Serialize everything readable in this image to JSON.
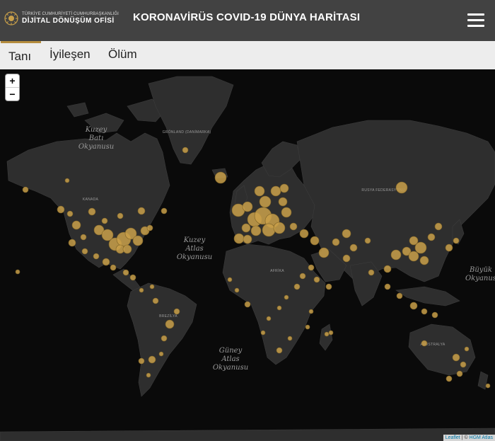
{
  "header": {
    "logo_top": "TÜRKİYE CUMHURİYETİ CUMHURBAŞKANLIĞI",
    "logo_main": "DİJİTAL DÖNÜŞÜM OFİSİ",
    "title": "KORONAVİRÜS COVID-19 DÜNYA HARİTASI",
    "menu_icon": "hamburger-menu-icon"
  },
  "tabs": [
    {
      "label": "Tanı",
      "active": true
    },
    {
      "label": "İyileşen",
      "active": false
    },
    {
      "label": "Ölüm",
      "active": false
    }
  ],
  "map": {
    "zoom_in": "+",
    "zoom_out": "−",
    "attribution_link": "Leaflet",
    "attribution_sep": " | © ",
    "attribution_source": "HGM Atlas",
    "oceans": [
      {
        "line1": "Kuzey",
        "line2": "Batı",
        "line3": "Okyanusu"
      },
      {
        "line1": "Kuzey",
        "line2": "Atlas",
        "line3": "Okyanusu"
      },
      {
        "line1": "Güney",
        "line2": "Atlas",
        "line3": "Okyanusu"
      },
      {
        "line1": "Büyük",
        "line2": "Okyanus",
        "line3": ""
      }
    ],
    "countries": [
      "GRÖNLAND (DANİMARKA)",
      "KANADA",
      "RUSYA FEDERASYONU",
      "BREZİLYA",
      "AVUSTRALYA",
      "AFRİKA"
    ]
  },
  "colors": {
    "header_bg": "#424242",
    "tab_bg": "#ededed",
    "tab_accent": "#b58d3e",
    "land": "#2e2e2e",
    "ocean": "#0a0a0a",
    "bubble": "#c9a04a"
  }
}
